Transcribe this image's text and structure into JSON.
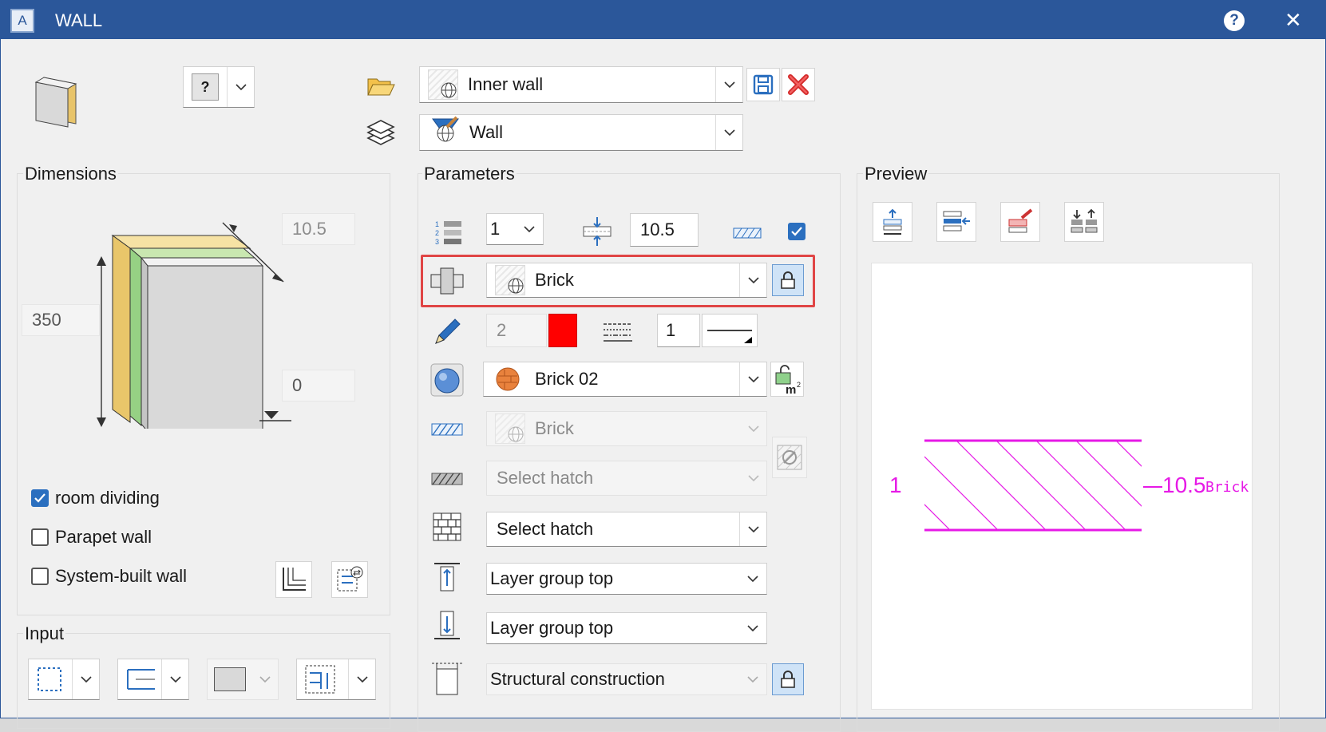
{
  "window": {
    "title": "WALL",
    "app_icon": "A"
  },
  "top": {
    "style_value": "Inner wall",
    "layer_value": "Wall"
  },
  "dimensions": {
    "label": "Dimensions",
    "thickness": "10.5",
    "height": "350",
    "bottom": "0",
    "room_dividing": "room dividing",
    "parapet_wall": "Parapet wall",
    "system_built_wall": "System-built wall"
  },
  "input": {
    "label": "Input"
  },
  "parameters": {
    "label": "Parameters",
    "layer_count": "1",
    "thickness": "10.5",
    "material": "Brick",
    "pen": "2",
    "line": "1",
    "surface": "Brick 02",
    "hatch1": "Brick",
    "hatch2": "Select hatch",
    "hatch3": "Select hatch",
    "top_ref": "Layer group top",
    "bottom_ref": "Layer group top",
    "construction": "Structural construction"
  },
  "preview": {
    "label": "Preview",
    "left_number": "1",
    "right_number": "10.5",
    "material_tag": "Brick"
  },
  "colors": {
    "title_bar": "#2b579a",
    "accent": "#2b6fbf",
    "highlight_frame": "#e04545",
    "pen_color": "#ff0000",
    "preview_magenta": "#e619e6"
  }
}
